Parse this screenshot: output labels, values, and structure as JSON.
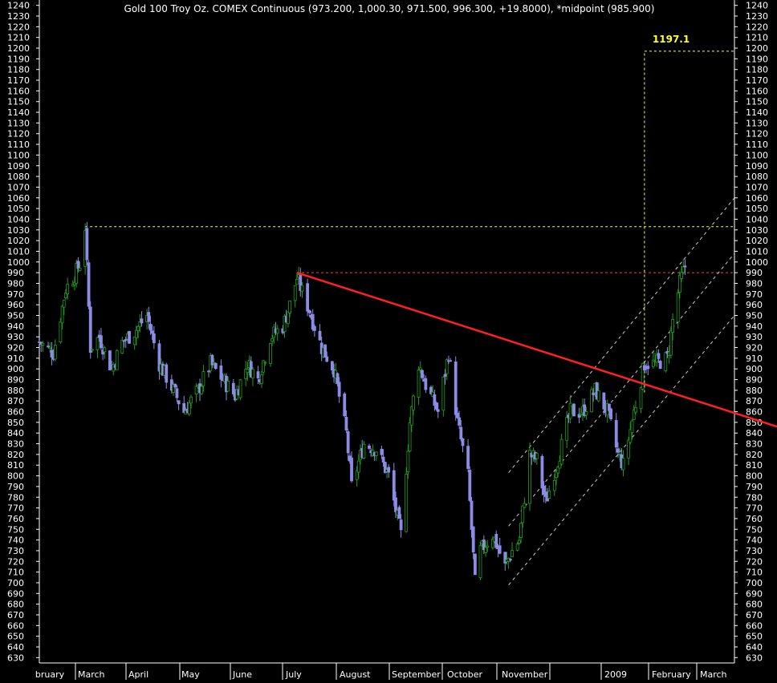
{
  "chart_data": {
    "type": "candlestick",
    "title": "Gold 100 Troy Oz. COMEX Continuous (973.200, 1,000.30, 971.500, 996.300, +19.8000), *midpoint (985.900)",
    "ylim": [
      625,
      1245
    ],
    "ytick_step": 10,
    "y_ticks_left": true,
    "y_ticks_right": true,
    "x_labels": [
      "bruary",
      "March",
      "April",
      "May",
      "June",
      "July",
      "August",
      "September",
      "October",
      "November",
      "",
      "2009",
      "February",
      "March"
    ],
    "x_date_range": [
      "2008-02-20",
      "2009-03-20"
    ],
    "colors": {
      "up": "#1e9e1e",
      "down": "#8c8ce6",
      "trendline": "#ff2020",
      "channel": "#cccccc",
      "resistance": "#ffff55",
      "level_990": "#ff4040",
      "background": "#000000",
      "text": "#ffffff",
      "target_text": "#ffff33"
    },
    "price_path": [
      [
        "2008-02-20",
        925
      ],
      [
        "2008-02-28",
        915
      ],
      [
        "2008-03-06",
        975
      ],
      [
        "2008-03-10",
        985
      ],
      [
        "2008-03-14",
        998
      ],
      [
        "2008-03-17",
        1033
      ],
      [
        "2008-03-20",
        920
      ],
      [
        "2008-03-25",
        930
      ],
      [
        "2008-04-01",
        900
      ],
      [
        "2008-04-07",
        925
      ],
      [
        "2008-04-14",
        935
      ],
      [
        "2008-04-21",
        950
      ],
      [
        "2008-04-28",
        905
      ],
      [
        "2008-05-06",
        880
      ],
      [
        "2008-05-12",
        860
      ],
      [
        "2008-05-20",
        880
      ],
      [
        "2008-05-27",
        905
      ],
      [
        "2008-06-03",
        890
      ],
      [
        "2008-06-10",
        875
      ],
      [
        "2008-06-17",
        905
      ],
      [
        "2008-06-23",
        890
      ],
      [
        "2008-06-30",
        930
      ],
      [
        "2008-07-07",
        940
      ],
      [
        "2008-07-11",
        960
      ],
      [
        "2008-07-15",
        985
      ],
      [
        "2008-07-22",
        955
      ],
      [
        "2008-07-29",
        920
      ],
      [
        "2008-08-05",
        900
      ],
      [
        "2008-08-12",
        840
      ],
      [
        "2008-08-15",
        790
      ],
      [
        "2008-08-22",
        830
      ],
      [
        "2008-08-29",
        825
      ],
      [
        "2008-09-05",
        800
      ],
      [
        "2008-09-10",
        760
      ],
      [
        "2008-09-12",
        745
      ],
      [
        "2008-09-17",
        850
      ],
      [
        "2008-09-22",
        905
      ],
      [
        "2008-09-26",
        885
      ],
      [
        "2008-10-03",
        860
      ],
      [
        "2008-10-09",
        915
      ],
      [
        "2008-10-14",
        850
      ],
      [
        "2008-10-20",
        800
      ],
      [
        "2008-10-24",
        700
      ],
      [
        "2008-10-27",
        730
      ],
      [
        "2008-11-03",
        745
      ],
      [
        "2008-11-10",
        715
      ],
      [
        "2008-11-14",
        730
      ],
      [
        "2008-11-18",
        740
      ],
      [
        "2008-11-24",
        820
      ],
      [
        "2008-11-28",
        815
      ],
      [
        "2008-12-03",
        775
      ],
      [
        "2008-12-10",
        815
      ],
      [
        "2008-12-17",
        860
      ],
      [
        "2008-12-24",
        860
      ],
      [
        "2008-12-31",
        880
      ],
      [
        "2009-01-07",
        860
      ],
      [
        "2009-01-13",
        820
      ],
      [
        "2009-01-16",
        810
      ],
      [
        "2009-01-22",
        860
      ],
      [
        "2009-01-28",
        905
      ],
      [
        "2009-02-03",
        905
      ],
      [
        "2009-02-10",
        910
      ],
      [
        "2009-02-13",
        945
      ],
      [
        "2009-02-17",
        980
      ],
      [
        "2009-02-20",
        996
      ]
    ],
    "annotations": {
      "trendline": {
        "from": [
          "2008-07-15",
          990
        ],
        "to": [
          "2009-03-20",
          846
        ]
      },
      "resistance_1033": {
        "value": 1033,
        "from": "2008-03-17",
        "to": "2009-03-20"
      },
      "level_990": {
        "value": 990,
        "from": "2008-07-15",
        "to": "2009-03-20"
      },
      "channel": [
        {
          "from": [
            "2008-11-12",
            803
          ],
          "to": [
            "2009-03-20",
            1060
          ]
        },
        {
          "from": [
            "2008-11-12",
            753
          ],
          "to": [
            "2009-03-20",
            1008
          ]
        },
        {
          "from": [
            "2008-11-12",
            698
          ],
          "to": [
            "2009-03-20",
            950
          ]
        }
      ],
      "target_line": {
        "date": "2009-01-28",
        "value": 1197.1,
        "from_value": 878
      },
      "target_label": "1197.1"
    }
  }
}
